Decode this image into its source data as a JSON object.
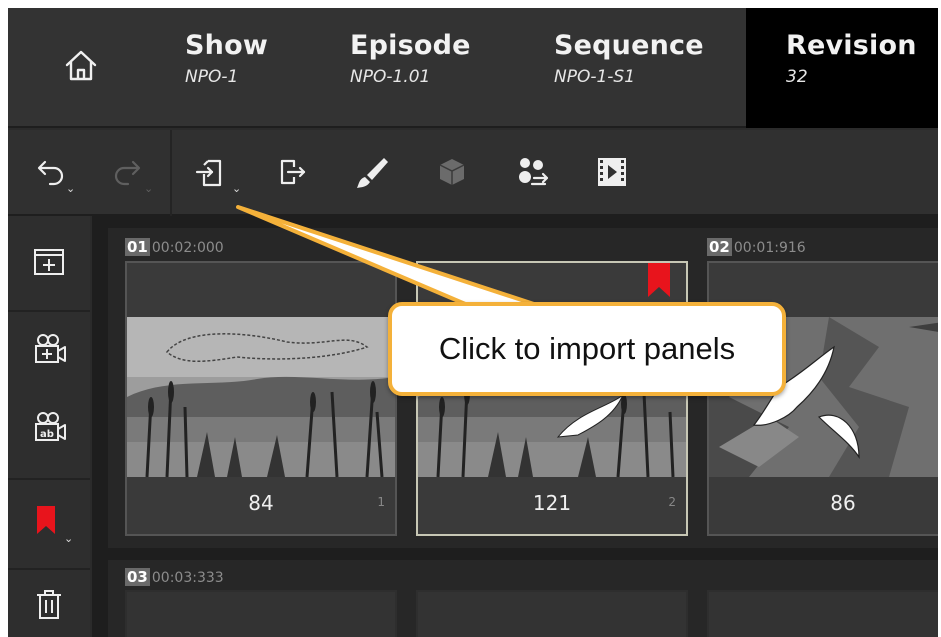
{
  "header": {
    "home_icon": "home-icon",
    "breadcrumbs": [
      {
        "title": "Show",
        "value": "NPO-1"
      },
      {
        "title": "Episode",
        "value": "NPO-1.01"
      },
      {
        "title": "Sequence",
        "value": "NPO-1-S1"
      },
      {
        "title": "Revision",
        "value": "32"
      }
    ]
  },
  "toolbar": {
    "icons": [
      "undo-icon",
      "redo-icon",
      "import-icon",
      "export-icon",
      "brush-icon",
      "3d-box-icon",
      "people-icon",
      "video-icon"
    ]
  },
  "sidebar": {
    "icons": [
      "new-panel-icon",
      "add-camera-icon",
      "camera-text-icon",
      "bookmark-icon",
      "trash-icon"
    ]
  },
  "scenes": [
    {
      "number": "01",
      "duration": "00:02:000",
      "panels": [
        {
          "value": "84",
          "index": "1"
        },
        {
          "value": "121",
          "index": "2"
        }
      ]
    },
    {
      "number": "02",
      "duration": "00:01:916",
      "panels": [
        {
          "value": "86",
          "index": ""
        }
      ]
    },
    {
      "number": "03",
      "duration": "00:03:333",
      "panels": []
    }
  ],
  "callout": {
    "text": "Click to import panels"
  },
  "colors": {
    "accent": "#f4b13a",
    "bookmark": "#e8141c",
    "active_crumb": "#000000"
  }
}
